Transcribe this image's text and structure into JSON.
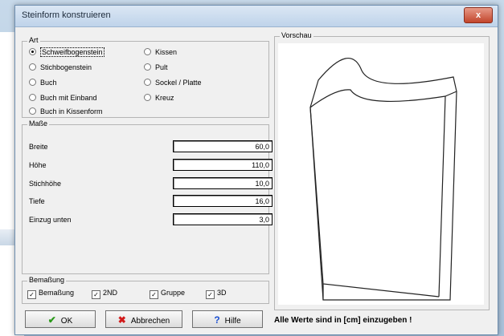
{
  "window": {
    "title": "Steinform konstruieren",
    "close_label": "x"
  },
  "art": {
    "label": "Art",
    "options_left": [
      {
        "label": "Schweifbogenstein",
        "selected": true
      },
      {
        "label": "Stichbogenstein",
        "selected": false
      },
      {
        "label": "Buch",
        "selected": false
      },
      {
        "label": "Buch mit Einband",
        "selected": false
      },
      {
        "label": "Buch in Kissenform",
        "selected": false
      }
    ],
    "options_right": [
      {
        "label": "Kissen",
        "selected": false
      },
      {
        "label": "Pult",
        "selected": false
      },
      {
        "label": "Sockel / Platte",
        "selected": false
      },
      {
        "label": "Kreuz",
        "selected": false
      }
    ]
  },
  "masse": {
    "label": "Maße",
    "fields": [
      {
        "label": "Breite",
        "value": "60,0"
      },
      {
        "label": "Höhe",
        "value": "110,0"
      },
      {
        "label": "Stichhöhe",
        "value": "10,0"
      },
      {
        "label": "Tiefe",
        "value": "16,0"
      },
      {
        "label": "Einzug unten",
        "value": "3,0"
      }
    ]
  },
  "bemassung": {
    "label": "Bemaßung",
    "checks": [
      {
        "label": "Bemaßung",
        "checked": true
      },
      {
        "label": "2ND",
        "checked": true
      },
      {
        "label": "Gruppe",
        "checked": true
      },
      {
        "label": "3D",
        "checked": true
      }
    ]
  },
  "buttons": {
    "ok": "OK",
    "cancel": "Abbrechen",
    "help": "Hilfe"
  },
  "preview": {
    "label": "Vorschau"
  },
  "status": "Alle Werte sind in [cm] einzugeben !",
  "colors": {
    "ok_icon": "#2a9a1a",
    "cancel_icon": "#d21a1a",
    "help_icon": "#1a4fd2"
  }
}
